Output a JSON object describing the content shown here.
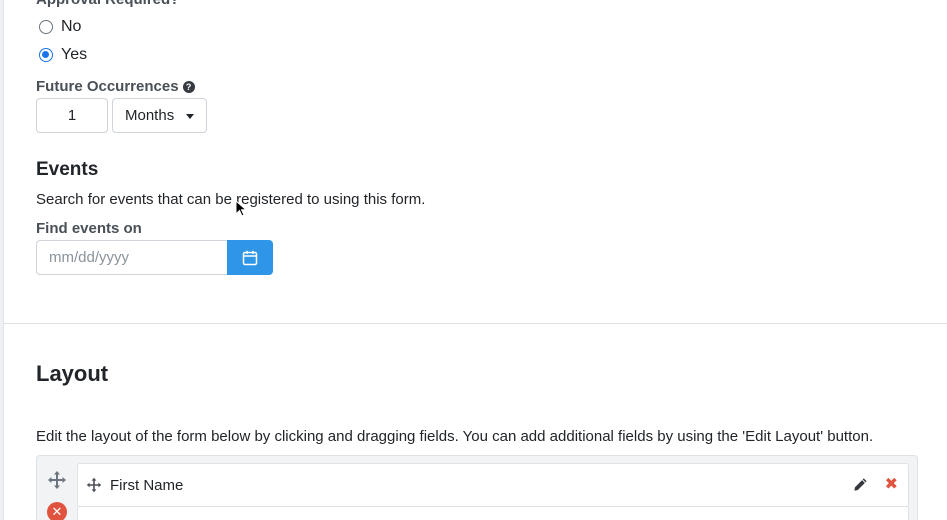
{
  "approval": {
    "label": "Approval Required?",
    "options": [
      {
        "label": "No",
        "checked": false
      },
      {
        "label": "Yes",
        "checked": true
      }
    ]
  },
  "future_occurrences": {
    "label": "Future Occurrences",
    "help_icon": "question-circle-icon",
    "value": "1",
    "unit": "Months"
  },
  "events": {
    "heading": "Events",
    "description": "Search for events that can be registered to using this form.",
    "find_label": "Find events on",
    "date_placeholder": "mm/dd/yyyy",
    "calendar_icon": "calendar-icon"
  },
  "layout": {
    "heading": "Layout",
    "description": "Edit the layout of the form below by clicking and dragging fields. You can add additional fields by using the 'Edit Layout' button.",
    "fields": [
      {
        "name": "First Name"
      }
    ]
  },
  "colors": {
    "primary": "#2f95e6",
    "danger": "#e0533f",
    "radio_selected": "#1a73e8"
  }
}
